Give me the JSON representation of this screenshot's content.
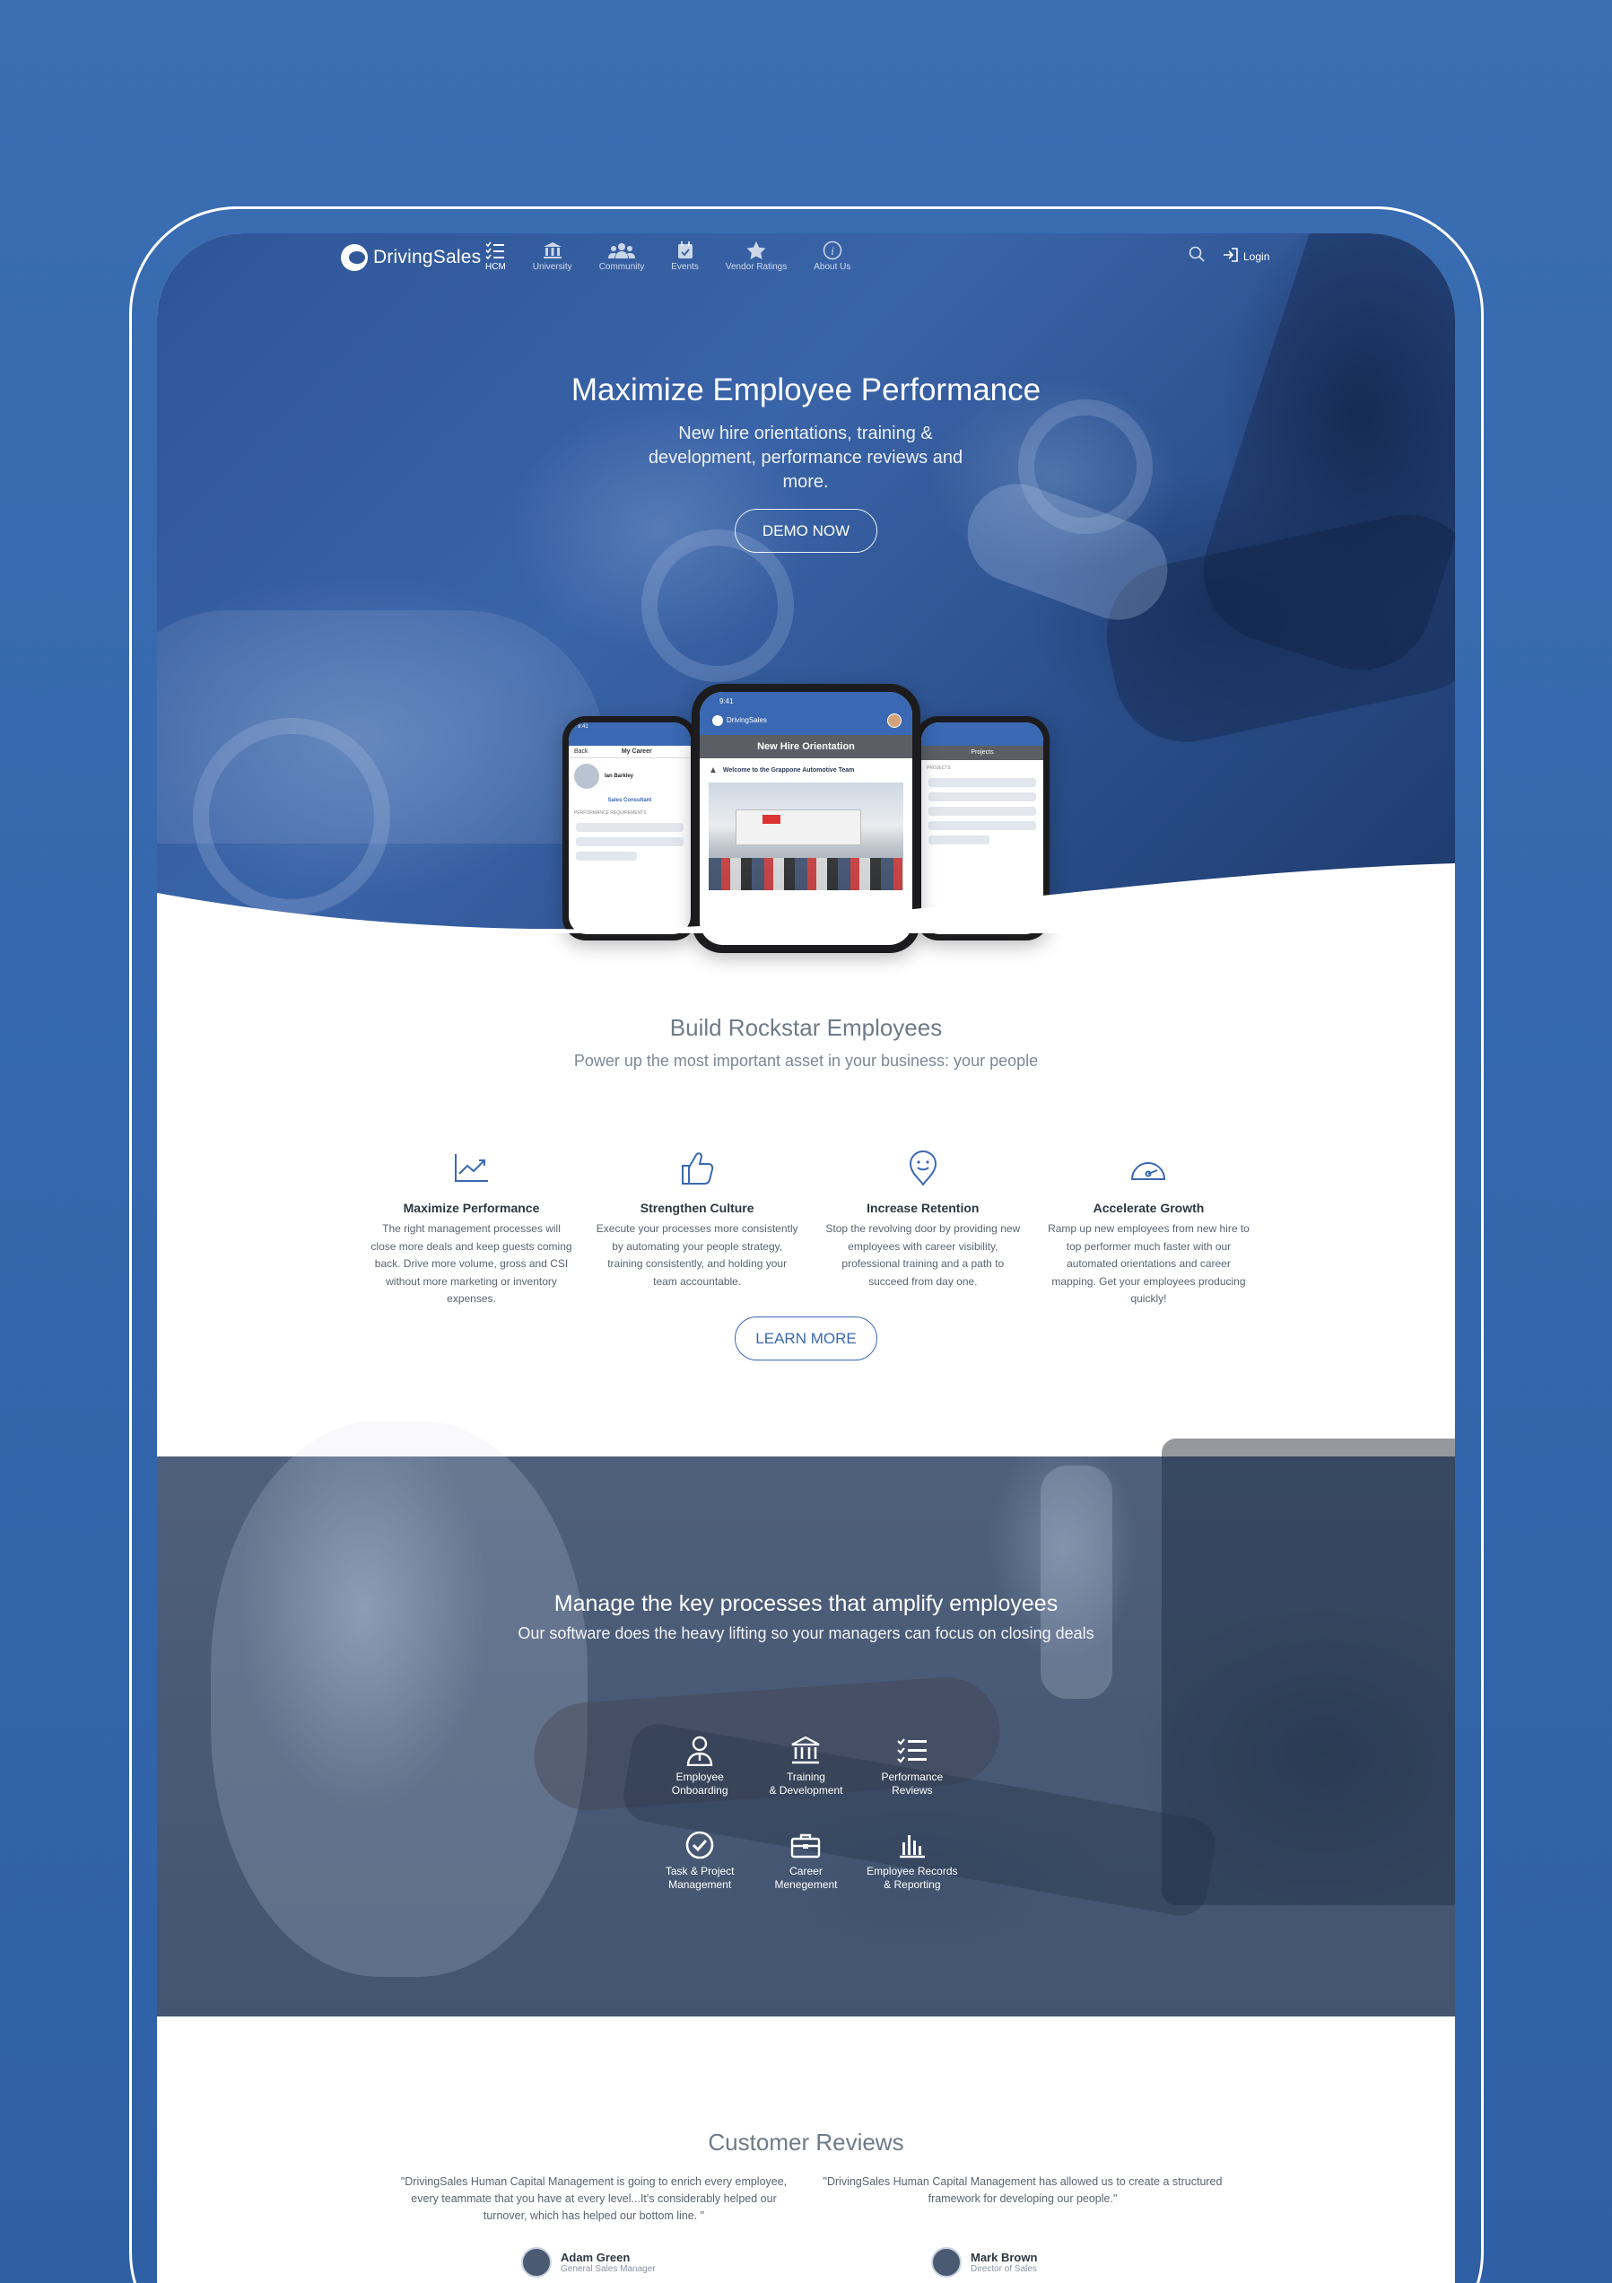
{
  "nav": {
    "logo_text": "DrivingSales",
    "items": [
      {
        "label": "HCM",
        "icon": "checklist-icon"
      },
      {
        "label": "University",
        "icon": "bank-icon"
      },
      {
        "label": "Community",
        "icon": "people-icon"
      },
      {
        "label": "Events",
        "icon": "calendar-icon"
      },
      {
        "label": "Vendor Ratings",
        "icon": "star-icon"
      },
      {
        "label": "About Us",
        "icon": "info-icon"
      }
    ],
    "login_label": "Login"
  },
  "hero": {
    "title": "Maximize Employee Performance",
    "subtitle": "New hire orientations, training & development, performance reviews and more.",
    "cta_label": "DEMO NOW"
  },
  "phones": {
    "left": {
      "time": "9:41",
      "screen_title": "My Career",
      "back_label": "Back",
      "user_name": "Ian Barkley",
      "role": "Sales Consultant",
      "section": "PERFORMANCE REQUIREMENTS"
    },
    "center": {
      "time": "9:41",
      "app_name": "DrivingSales",
      "screen_title": "New Hire Orientation",
      "card_title": "Welcome to the Grappone Automotive Team"
    },
    "right": {
      "screen_title": "Projects",
      "section": "PROJECTS"
    }
  },
  "features_section": {
    "title": "Build Rockstar Employees",
    "subtitle": "Power up the most important asset in your business: your people",
    "items": [
      {
        "icon": "trend-chart-icon",
        "title": "Maximize Performance",
        "text": "The right management processes will close more deals and keep guests coming back. Drive more volume, gross and CSI without more marketing or inventory expenses."
      },
      {
        "icon": "thumbs-up-icon",
        "title": "Strengthen Culture",
        "text": "Execute your processes more consistently by automating your people strategy, training consistently, and holding your team accountable."
      },
      {
        "icon": "smiley-pin-icon",
        "title": "Increase Retention",
        "text": "Stop the revolving door by providing new employees with career visibility, professional training and a path to succeed from day one."
      },
      {
        "icon": "speedometer-icon",
        "title": "Accelerate Growth",
        "text": "Ramp up new employees from new hire to top performer much faster with our automated orientations and career mapping. Get your employees producing quickly!"
      }
    ],
    "cta_label": "LEARN MORE"
  },
  "process_section": {
    "title": "Manage the key processes that amplify employees",
    "subtitle": "Our software does the heavy lifting so your managers can focus on closing deals",
    "items": [
      {
        "icon": "employee-icon",
        "label": "Employee\nOnboarding"
      },
      {
        "icon": "bank-icon",
        "label": "Training\n& Development"
      },
      {
        "icon": "checklist-icon",
        "label": "Performance\nReviews"
      },
      {
        "icon": "check-circle-icon",
        "label": "Task & Project\nManagement"
      },
      {
        "icon": "briefcase-icon",
        "label": "Career\nMenegement"
      },
      {
        "icon": "bar-chart-icon",
        "label": "Employee Records\n& Reporting"
      }
    ]
  },
  "reviews_section": {
    "title": "Customer Reviews",
    "reviews": [
      {
        "quote": "\"DrivingSales Human Capital Management is going to enrich every employee, every teammate that you have at every level...It's considerably helped our turnover, which has helped our bottom line. \"",
        "name": "Adam Green",
        "role": "General Sales Manager"
      },
      {
        "quote": "\"DrivingSales Human Capital Management has allowed us to create a structured framework for developing our people.\"",
        "name": "Mark Brown",
        "role": "Director of Sales"
      }
    ]
  },
  "colors": {
    "brand_blue": "#3a68b3",
    "page_background": "#3467ad"
  }
}
